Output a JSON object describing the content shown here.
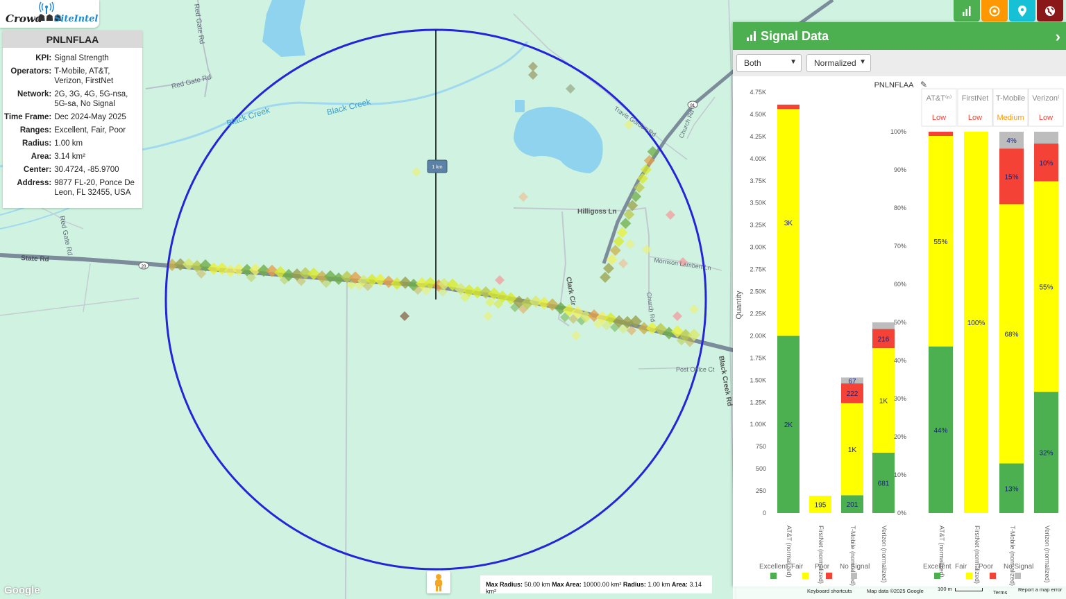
{
  "logo": {
    "part1": "Crowd",
    "part2": "SiteIntel"
  },
  "info": {
    "title": "PNLNFLAA",
    "rows": [
      {
        "k": "KPI:",
        "v": "Signal Strength"
      },
      {
        "k": "Operators:",
        "v": "T-Mobile, AT&T, Verizon, FirstNet"
      },
      {
        "k": "Network:",
        "v": "2G, 3G, 4G, 5G-nsa, 5G-sa, No Signal"
      },
      {
        "k": "Time Frame:",
        "v": "Dec 2024-May 2025"
      },
      {
        "k": "Ranges:",
        "v": "Excellent, Fair, Poor"
      },
      {
        "k": "Radius:",
        "v": "1.00 km"
      },
      {
        "k": "Area:",
        "v": "3.14 km²"
      },
      {
        "k": "Center:",
        "v": "30.4724, -85.9700"
      },
      {
        "k": "Address:",
        "v": "9877 FL-20, Ponce De Leon, FL 32455, USA"
      }
    ]
  },
  "map": {
    "labels": {
      "red_gate_rd_1": "Red Gate Rd",
      "red_gate_rd_2": "Red Gate Rd",
      "red_gate_rd_3": "Red Gate Rd",
      "black_creek_1": "Black Creek",
      "black_creek_2": "Black Creek",
      "state_rd": "State Rd",
      "hilligoss": "Hilligoss Ln",
      "morrison": "Morrison Lambert Ln",
      "clark": "Clark Cir",
      "church_rd": "Church Rd",
      "church_rd_2": "Church Rd",
      "travis": "Travis Gordon Rd",
      "post_office": "Post Office Ct",
      "black_creek_rd": "Black Creek Rd",
      "shield_20": "20",
      "shield_81": "81",
      "radius_label": "1 km"
    },
    "scale_text": {
      "max_radius_k": "Max Radius:",
      "max_radius_v": "50.00 km",
      "max_area_k": "Max Area:",
      "max_area_v": "10000.00 km²",
      "radius_k": "Radius:",
      "radius_v": "1.00 km",
      "area_k": "Area:",
      "area_v": "3.14 km²"
    },
    "google": "Google",
    "footer": {
      "shortcuts": "Keyboard shortcuts",
      "mapdata": "Map data ©2025 Google",
      "scale": "100 m",
      "terms": "Terms",
      "report": "Report a map error"
    }
  },
  "panel": {
    "title": "Signal Data",
    "select1": "Both",
    "select2": "Normalized",
    "chart_title": "PNLNFLAA",
    "colors": {
      "excellent": "#4caf50",
      "fair": "#ffff00",
      "poor": "#f44336",
      "nosignal": "#bdbdbd"
    },
    "legend": [
      "Excellent",
      "Fair",
      "Poor",
      "No Signal"
    ],
    "left_axis_title": "Quantity",
    "left_ticks": [
      "0",
      "250",
      "500",
      "750",
      "1.00K",
      "1.25K",
      "1.50K",
      "1.75K",
      "2.00K",
      "2.25K",
      "2.50K",
      "2.75K",
      "3.00K",
      "3.25K",
      "3.50K",
      "3.75K",
      "4.00K",
      "4.25K",
      "4.50K",
      "4.75K"
    ],
    "right_ticks": [
      "0%",
      "10%",
      "20%",
      "30%",
      "40%",
      "50%",
      "60%",
      "70%",
      "80%",
      "90%",
      "100%"
    ],
    "op_headers": [
      "AT&T⁽ⁿ⁾",
      "FirstNet",
      "T-Mobile",
      "Verizon⁽"
    ],
    "op_levels": [
      "Low",
      "Low",
      "Medium",
      "Low"
    ],
    "level_colors": [
      "#f44336",
      "#f44336",
      "#ff9800",
      "#f44336"
    ],
    "x_labels": [
      "AT&T (normalized)",
      "FirstNet (normalized)",
      "T-Mobile (normalized)",
      "Verizon (normalized)"
    ]
  },
  "chart_data": [
    {
      "type": "bar",
      "stacked": true,
      "title": "PNLNFLAA",
      "ylabel": "Quantity",
      "ylim": [
        0,
        4750
      ],
      "categories": [
        "AT&T (normalized)",
        "FirstNet (normalized)",
        "T-Mobile (normalized)",
        "Verizon (normalized)"
      ],
      "series": [
        {
          "name": "Excellent",
          "values": [
            2000,
            0,
            201,
            681
          ],
          "labels": [
            "2K",
            "",
            "201",
            "681"
          ]
        },
        {
          "name": "Fair",
          "values": [
            2560,
            195,
            1040,
            1180
          ],
          "labels": [
            "3K",
            "195",
            "1K",
            "1K"
          ]
        },
        {
          "name": "Poor",
          "values": [
            50,
            0,
            222,
            216
          ],
          "labels": [
            "",
            "",
            "222",
            "216"
          ]
        },
        {
          "name": "No Signal",
          "values": [
            0,
            0,
            67,
            75
          ],
          "labels": [
            "",
            "",
            "67",
            ""
          ]
        }
      ]
    },
    {
      "type": "bar",
      "stacked": true,
      "ylim": [
        0,
        100
      ],
      "categories": [
        "AT&T (normalized)",
        "FirstNet (normalized)",
        "T-Mobile (normalized)",
        "Verizon (normalized)"
      ],
      "series": [
        {
          "name": "Excellent",
          "values": [
            43.7,
            0,
            13,
            31.8
          ],
          "labels": [
            "44%",
            "",
            "13%",
            "32%"
          ]
        },
        {
          "name": "Fair",
          "values": [
            55.2,
            100,
            68,
            55.2
          ],
          "labels": [
            "55%",
            "100%",
            "68%",
            "55%"
          ]
        },
        {
          "name": "Poor",
          "values": [
            1.1,
            0,
            14.6,
            9.9
          ],
          "labels": [
            "",
            "",
            "15%",
            "10%"
          ]
        },
        {
          "name": "No Signal",
          "values": [
            0,
            0,
            4.4,
            3.1
          ],
          "labels": [
            "",
            "",
            "4%",
            ""
          ]
        }
      ]
    }
  ]
}
